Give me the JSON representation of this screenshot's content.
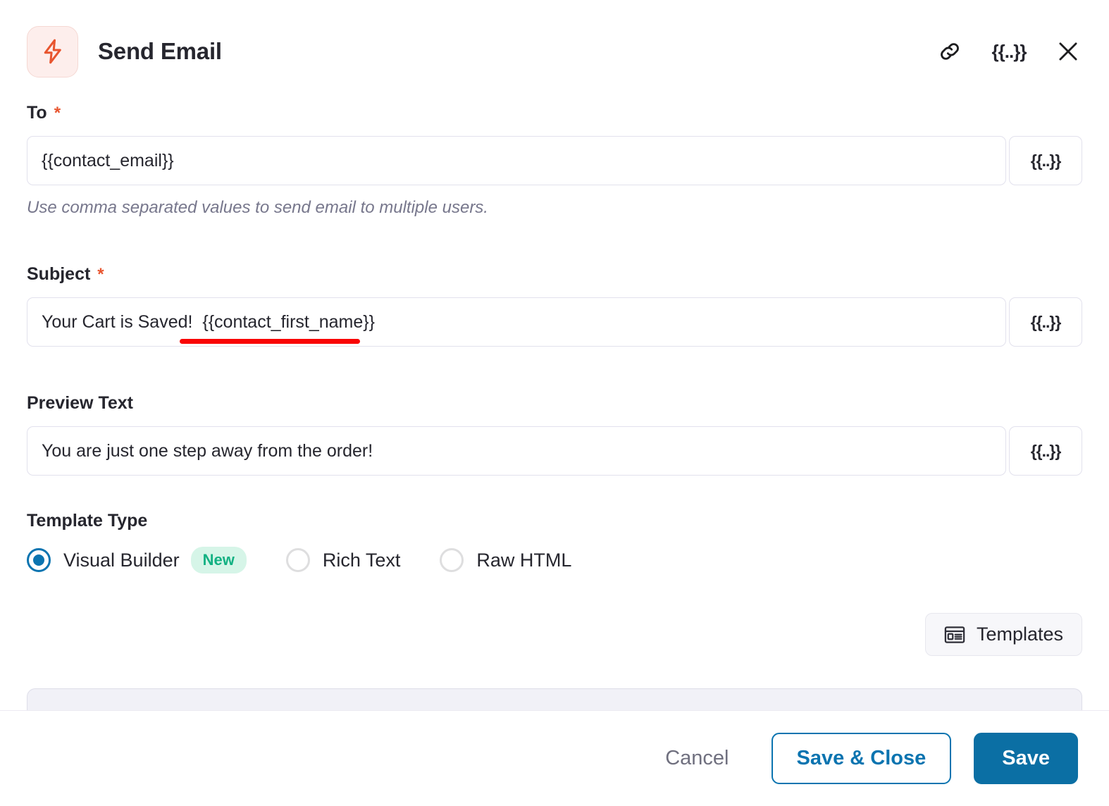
{
  "header": {
    "title": "Send Email",
    "icon": "lightning-bolt-icon",
    "actions": [
      {
        "name": "link-icon",
        "label": ""
      },
      {
        "name": "merge-tag-icon",
        "label": "{{..}}"
      },
      {
        "name": "close-icon",
        "label": ""
      }
    ]
  },
  "fields": {
    "to": {
      "label": "To",
      "required": true,
      "required_marker": "*",
      "value": "{{contact_email}}",
      "placeholder": "",
      "helper": "Use comma separated values to send email to multiple users.",
      "merge_button": "{{..}}"
    },
    "subject": {
      "label": "Subject",
      "required": true,
      "required_marker": "*",
      "value": "Your Cart is Saved!  {{contact_first_name}}",
      "placeholder": "",
      "merge_button": "{{..}}"
    },
    "preview_text": {
      "label": "Preview Text",
      "required": false,
      "value": "You are just one step away from the order!",
      "placeholder": "",
      "merge_button": "{{..}}"
    }
  },
  "template_type": {
    "label": "Template Type",
    "selected": "Visual Builder",
    "options": [
      {
        "label": "Visual Builder",
        "selected": true,
        "badge": "New"
      },
      {
        "label": "Rich Text",
        "selected": false,
        "badge": ""
      },
      {
        "label": "Raw HTML",
        "selected": false,
        "badge": ""
      }
    ]
  },
  "templates_button": {
    "label": "Templates",
    "icon": "template-layout-icon"
  },
  "footer": {
    "cancel_label": "Cancel",
    "save_close_label": "Save & Close",
    "save_label": "Save"
  },
  "colors": {
    "accent_blue": "#0b6fa4",
    "bolt_orange": "#e8552f",
    "badge_green_text": "#13b183",
    "badge_green_bg": "#d6f5e8",
    "required_red": "#e8552f",
    "annotation_red": "#f90505"
  }
}
